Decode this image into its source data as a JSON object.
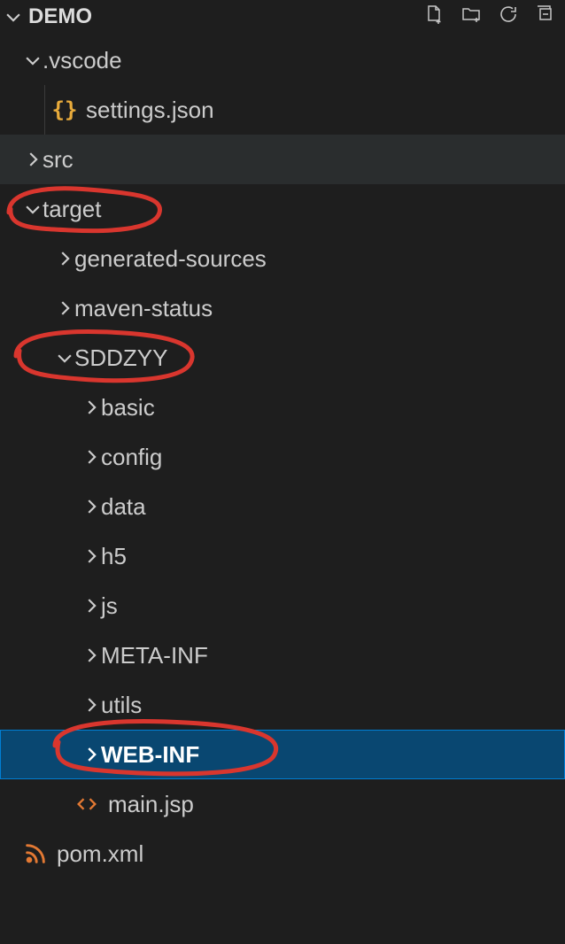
{
  "project": {
    "name": "DEMO"
  },
  "actions": {
    "new_file": "New File",
    "new_folder": "New Folder",
    "refresh": "Refresh",
    "collapse": "Collapse All"
  },
  "tree": {
    "vscode": {
      "label": ".vscode",
      "expanded": true
    },
    "settings": {
      "label": "settings.json"
    },
    "src": {
      "label": "src",
      "expanded": false
    },
    "target": {
      "label": "target",
      "expanded": true
    },
    "generated_sources": {
      "label": "generated-sources",
      "expanded": false
    },
    "maven_status": {
      "label": "maven-status",
      "expanded": false
    },
    "sddzyy": {
      "label": "SDDZYY",
      "expanded": true
    },
    "basic": {
      "label": "basic",
      "expanded": false
    },
    "config": {
      "label": "config",
      "expanded": false
    },
    "data": {
      "label": "data",
      "expanded": false
    },
    "h5": {
      "label": "h5",
      "expanded": false
    },
    "js": {
      "label": "js",
      "expanded": false
    },
    "meta_inf": {
      "label": "META-INF",
      "expanded": false
    },
    "utils": {
      "label": "utils",
      "expanded": false
    },
    "web_inf": {
      "label": "WEB-INF",
      "expanded": false,
      "selected": true
    },
    "main_jsp": {
      "label": "main.jsp"
    },
    "pom_xml": {
      "label": "pom.xml"
    }
  },
  "colors": {
    "background": "#1e1e1e",
    "text": "#cccccc",
    "selection_bg": "#094771",
    "selection_border": "#007fd4",
    "annotation": "#d9362e",
    "json_icon": "#e8ab3b",
    "rss_icon": "#e37933"
  }
}
